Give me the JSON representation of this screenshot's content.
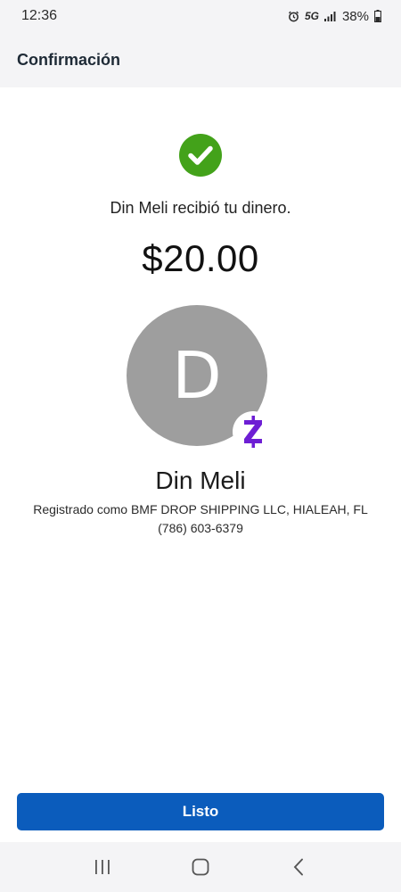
{
  "status_bar": {
    "time": "12:36",
    "network": "5G",
    "battery": "38%",
    "icons": [
      "alarm-icon",
      "signal-icon",
      "battery-icon"
    ]
  },
  "header": {
    "title": "Confirmación"
  },
  "confirmation": {
    "status_icon": "check-circle-icon",
    "message": "Din Meli recibió tu dinero.",
    "amount": "$20.00",
    "recipient": {
      "initial": "D",
      "name": "Din Meli",
      "registered_as": "Registrado como BMF DROP SHIPPING LLC, HIALEAH, FL",
      "phone": "(786) 603-6379",
      "badge_icon": "zelle-icon"
    }
  },
  "actions": {
    "done_label": "Listo"
  },
  "nav_bar": {
    "icons": [
      "recent-apps-icon",
      "home-icon",
      "back-icon"
    ]
  },
  "colors": {
    "success": "#43a21a",
    "button": "#0b5cbc",
    "zelle": "#6d1ed4",
    "avatar": "#9e9e9e",
    "header_bg": "#f4f4f6"
  }
}
